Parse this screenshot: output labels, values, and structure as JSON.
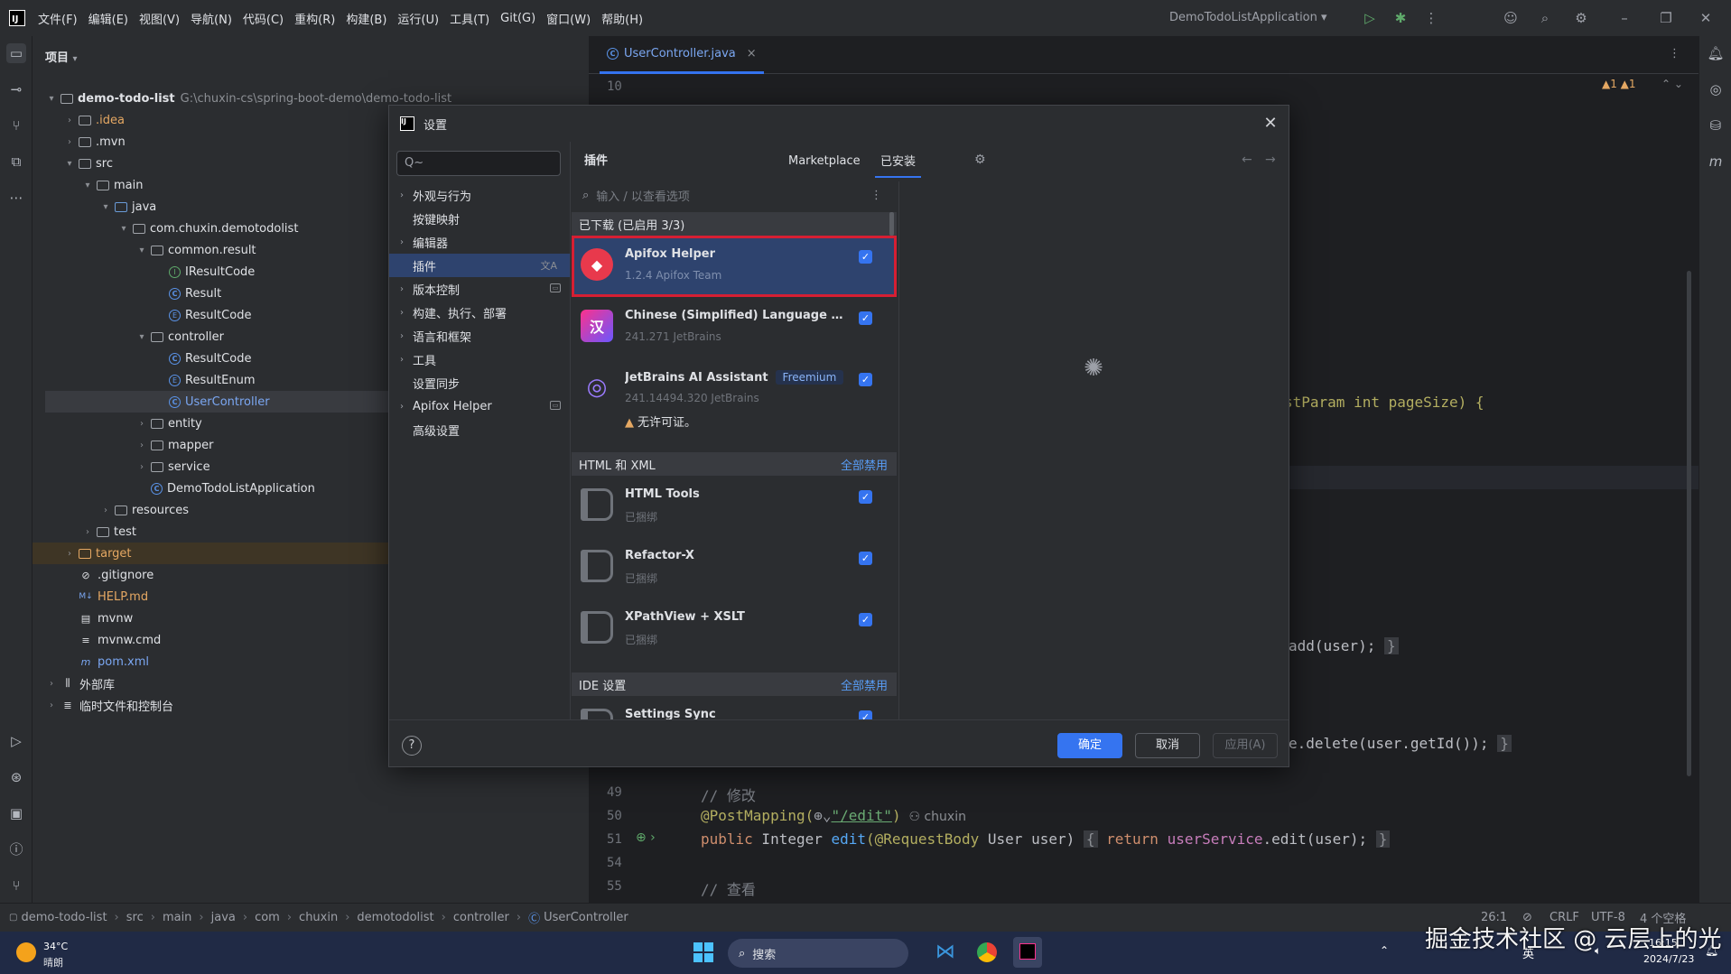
{
  "menu": [
    "文件(F)",
    "编辑(E)",
    "视图(V)",
    "导航(N)",
    "代码(C)",
    "重构(R)",
    "构建(B)",
    "运行(U)",
    "工具(T)",
    "Git(G)",
    "窗口(W)",
    "帮助(H)"
  ],
  "run_config": "DemoTodoListApplication",
  "project": {
    "header": "项目",
    "tree": [
      {
        "label": "demo-todo-list",
        "path": "G:\\chuxin-cs\\spring-boot-demo\\demo-todo-list"
      },
      {
        "label": ".idea"
      },
      {
        "label": ".mvn"
      },
      {
        "label": "src"
      },
      {
        "label": "main"
      },
      {
        "label": "java"
      },
      {
        "label": "com.chuxin.demotodolist"
      },
      {
        "label": "common.result"
      },
      {
        "label": "IResultCode"
      },
      {
        "label": "Result"
      },
      {
        "label": "ResultCode"
      },
      {
        "label": "controller"
      },
      {
        "label": "ResultCode"
      },
      {
        "label": "ResultEnum"
      },
      {
        "label": "UserController"
      },
      {
        "label": "entity"
      },
      {
        "label": "mapper"
      },
      {
        "label": "service"
      },
      {
        "label": "DemoTodoListApplication"
      },
      {
        "label": "resources"
      },
      {
        "label": "test"
      },
      {
        "label": "target"
      },
      {
        "label": ".gitignore"
      },
      {
        "label": "HELP.md"
      },
      {
        "label": "mvnw"
      },
      {
        "label": "mvnw.cmd"
      },
      {
        "label": "pom.xml"
      },
      {
        "label": "外部库"
      },
      {
        "label": "临时文件和控制台"
      }
    ]
  },
  "editor": {
    "tab": "UserController.java",
    "warnings": "▲1 ▲1",
    "lines": {
      "l10": "10",
      "l49": "49",
      "l50": "50",
      "l51": "51",
      "l54": "54",
      "l55": "55",
      "frag_pagesize": "stParam int pageSize) {",
      "frag_add": "add(user);",
      "frag_delete": "e.delete(user.getId());",
      "comment_modify": "// 修改",
      "anno_post": "@PostMapping(",
      "anno_path": "\"/edit\"",
      "anno_close": ")",
      "author": "chuxin",
      "sig_public": "public",
      "sig_type": " Integer ",
      "sig_name": "edit",
      "sig_anno": "(@RequestBody",
      "sig_rest": " User user) ",
      "sig_return": "return",
      "sig_field": " userService",
      "sig_call": ".edit(user);",
      "comment_view": "// 查看"
    }
  },
  "dialog": {
    "title": "设置",
    "search_placeholder": "Q~",
    "nav": [
      {
        "label": "外观与行为",
        "chevron": true
      },
      {
        "label": "按键映射",
        "chevron": false
      },
      {
        "label": "编辑器",
        "chevron": true
      },
      {
        "label": "插件",
        "chevron": false,
        "active": true
      },
      {
        "label": "版本控制",
        "chevron": true
      },
      {
        "label": "构建、执行、部署",
        "chevron": true
      },
      {
        "label": "语言和框架",
        "chevron": true
      },
      {
        "label": "工具",
        "chevron": true
      },
      {
        "label": "设置同步",
        "chevron": false
      },
      {
        "label": "Apifox Helper",
        "chevron": true
      },
      {
        "label": "高级设置",
        "chevron": false
      }
    ],
    "plugins_heading": "插件",
    "tabs": {
      "marketplace": "Marketplace",
      "installed": "已安装"
    },
    "plugin_search_placeholder": "输入 / 以查看选项",
    "sections": {
      "downloaded": "已下载 (已启用 3/3)",
      "html_xml": "HTML 和 XML",
      "ide_settings": "IDE 设置",
      "disable_all": "全部禁用"
    },
    "plugins": [
      {
        "name": "Apifox Helper",
        "meta": "1.2.4  Apifox Team",
        "checked": true
      },
      {
        "name": "Chinese (Simplified) Language Pac...",
        "meta": "241.271  JetBrains",
        "checked": true
      },
      {
        "name": "JetBrains AI Assistant",
        "badge": "Freemium",
        "meta": "241.14494.320  JetBrains",
        "warning": "无许可证。",
        "checked": true
      },
      {
        "name": "HTML Tools",
        "meta": "已捆绑",
        "checked": true
      },
      {
        "name": "Refactor-X",
        "meta": "已捆绑",
        "checked": true
      },
      {
        "name": "XPathView + XSLT",
        "meta": "已捆绑",
        "checked": true
      },
      {
        "name": "Settings Sync",
        "checked": true
      }
    ],
    "buttons": {
      "help": "?",
      "ok": "确定",
      "cancel": "取消",
      "apply": "应用(A)"
    }
  },
  "status": {
    "breadcrumb": [
      "demo-todo-list",
      "src",
      "main",
      "java",
      "com",
      "chuxin",
      "demotodolist",
      "controller",
      "UserController"
    ],
    "position": "26:1",
    "line_sep": "CRLF",
    "encoding": "UTF-8",
    "indent": "4 个空格"
  },
  "taskbar": {
    "weather_temp": "34°C",
    "weather_desc": "晴朗",
    "search": "搜索",
    "ime": "英",
    "time": "16:15",
    "date": "2024/7/23"
  },
  "watermark": "掘金技术社区 @ 云层上的光",
  "colors": {
    "accent": "#3574f0",
    "selection_outline": "#d61f33",
    "apifox": "#e8394c"
  }
}
